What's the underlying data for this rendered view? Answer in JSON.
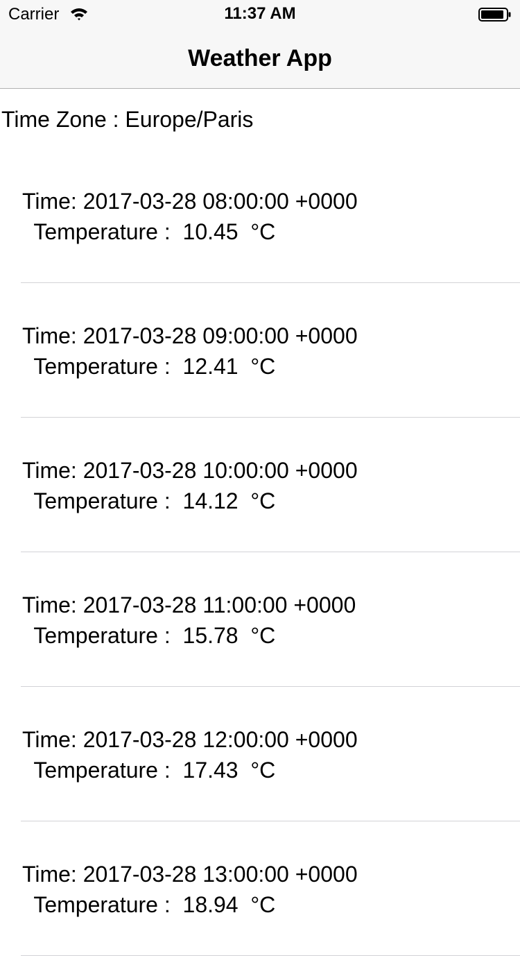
{
  "status_bar": {
    "carrier": "Carrier",
    "time": "11:37 AM",
    "wifi_icon": "wifi-icon",
    "battery_icon": "battery-icon"
  },
  "nav": {
    "title": "Weather App"
  },
  "timezone_label": "Time Zone : Europe/Paris",
  "forecast": [
    {
      "time": "Time: 2017-03-28 08:00:00 +0000",
      "temperature": " Temperature :  10.45  °C"
    },
    {
      "time": "Time: 2017-03-28 09:00:00 +0000",
      "temperature": " Temperature :  12.41  °C"
    },
    {
      "time": "Time: 2017-03-28 10:00:00 +0000",
      "temperature": " Temperature :  14.12  °C"
    },
    {
      "time": "Time: 2017-03-28 11:00:00 +0000",
      "temperature": " Temperature :  15.78  °C"
    },
    {
      "time": "Time: 2017-03-28 12:00:00 +0000",
      "temperature": " Temperature :  17.43  °C"
    },
    {
      "time": "Time: 2017-03-28 13:00:00 +0000",
      "temperature": " Temperature :  18.94  °C"
    }
  ]
}
